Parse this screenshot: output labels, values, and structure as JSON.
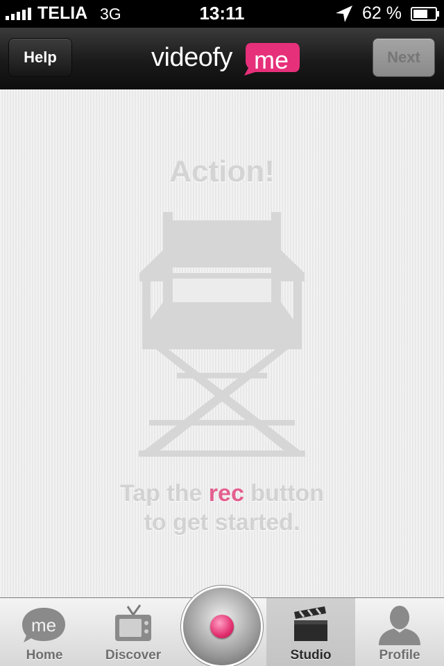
{
  "status_bar": {
    "carrier": "TELIA",
    "network": "3G",
    "time": "13:11",
    "battery_percent": "62 %"
  },
  "navbar": {
    "help_label": "Help",
    "next_label": "Next",
    "logo_word": "videofy",
    "logo_bubble": "me"
  },
  "main": {
    "heading": "Action!",
    "hint_prefix": "Tap the ",
    "hint_highlight": "rec",
    "hint_suffix": " button",
    "hint_line2": "to get started."
  },
  "tabs": [
    {
      "label": "Home",
      "icon": "me-bubble-icon"
    },
    {
      "label": "Discover",
      "icon": "tv-icon"
    },
    {
      "label": "Studio",
      "icon": "clapperboard-icon",
      "active": true
    },
    {
      "label": "Profile",
      "icon": "person-icon"
    }
  ],
  "colors": {
    "accent_pink": "#e3608f",
    "heading_grey": "#d4d4d4"
  }
}
